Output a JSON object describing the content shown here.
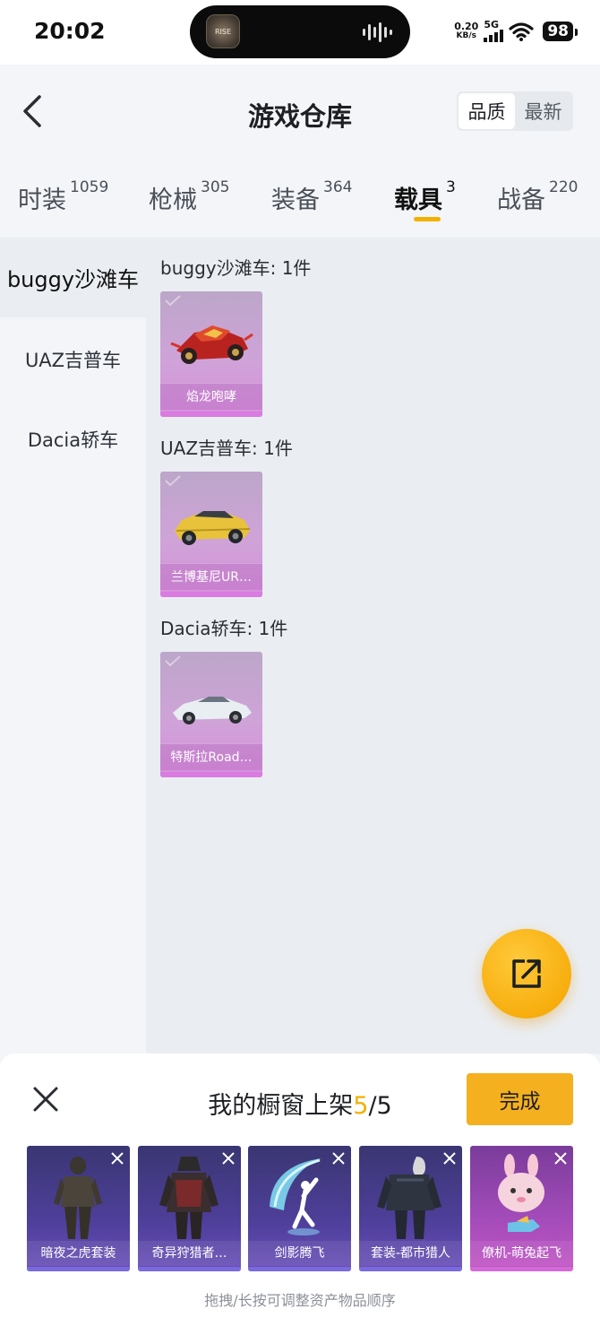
{
  "status_bar": {
    "time": "20:02",
    "island_app": "RISE",
    "net_speed_value": "0.20",
    "net_speed_unit": "KB/s",
    "network": "5G",
    "battery": "98"
  },
  "header": {
    "title": "游戏仓库",
    "sort_options": [
      "品质",
      "最新"
    ],
    "sort_selected": "品质"
  },
  "tabs": [
    {
      "label": "时装",
      "count": "1059"
    },
    {
      "label": "枪械",
      "count": "305"
    },
    {
      "label": "装备",
      "count": "364"
    },
    {
      "label": "载具",
      "count": "3",
      "active": true
    },
    {
      "label": "战备",
      "count": "220"
    }
  ],
  "sidebar": {
    "items": [
      {
        "label": "buggy沙滩车",
        "active": true
      },
      {
        "label": "UAZ吉普车"
      },
      {
        "label": "Dacia轿车"
      }
    ]
  },
  "groups": [
    {
      "title": "buggy沙滩车: 1件",
      "items": [
        {
          "name": "焰龙咆哮",
          "icon": "red-buggy-icon"
        }
      ]
    },
    {
      "title": "UAZ吉普车: 1件",
      "items": [
        {
          "name": "兰博基尼UR…",
          "icon": "yellow-suv-icon"
        }
      ]
    },
    {
      "title": "Dacia轿车: 1件",
      "items": [
        {
          "name": "特斯拉Road…",
          "icon": "white-roadster-icon"
        }
      ]
    }
  ],
  "panel": {
    "title_prefix": "我的橱窗上架",
    "count": "5",
    "total": "/5",
    "done_label": "完成",
    "hint": "拖拽/长按可调整资产物品顺序",
    "items": [
      {
        "name": "暗夜之虎套装",
        "icon": "night-tiger-outfit-icon"
      },
      {
        "name": "奇异狩猎者…",
        "icon": "hunter-outfit-icon"
      },
      {
        "name": "剑影腾飞",
        "icon": "sword-dance-icon"
      },
      {
        "name": "套装-都市猎人",
        "icon": "urban-hunter-outfit-icon"
      },
      {
        "name": "僚机-萌兔起飞",
        "icon": "bunny-plane-icon"
      }
    ]
  },
  "colors": {
    "accent": "#f2b100",
    "fab": "#f7ae0e",
    "item_pink": "#cfa3d8",
    "item_purple": "#4e3f9a"
  }
}
